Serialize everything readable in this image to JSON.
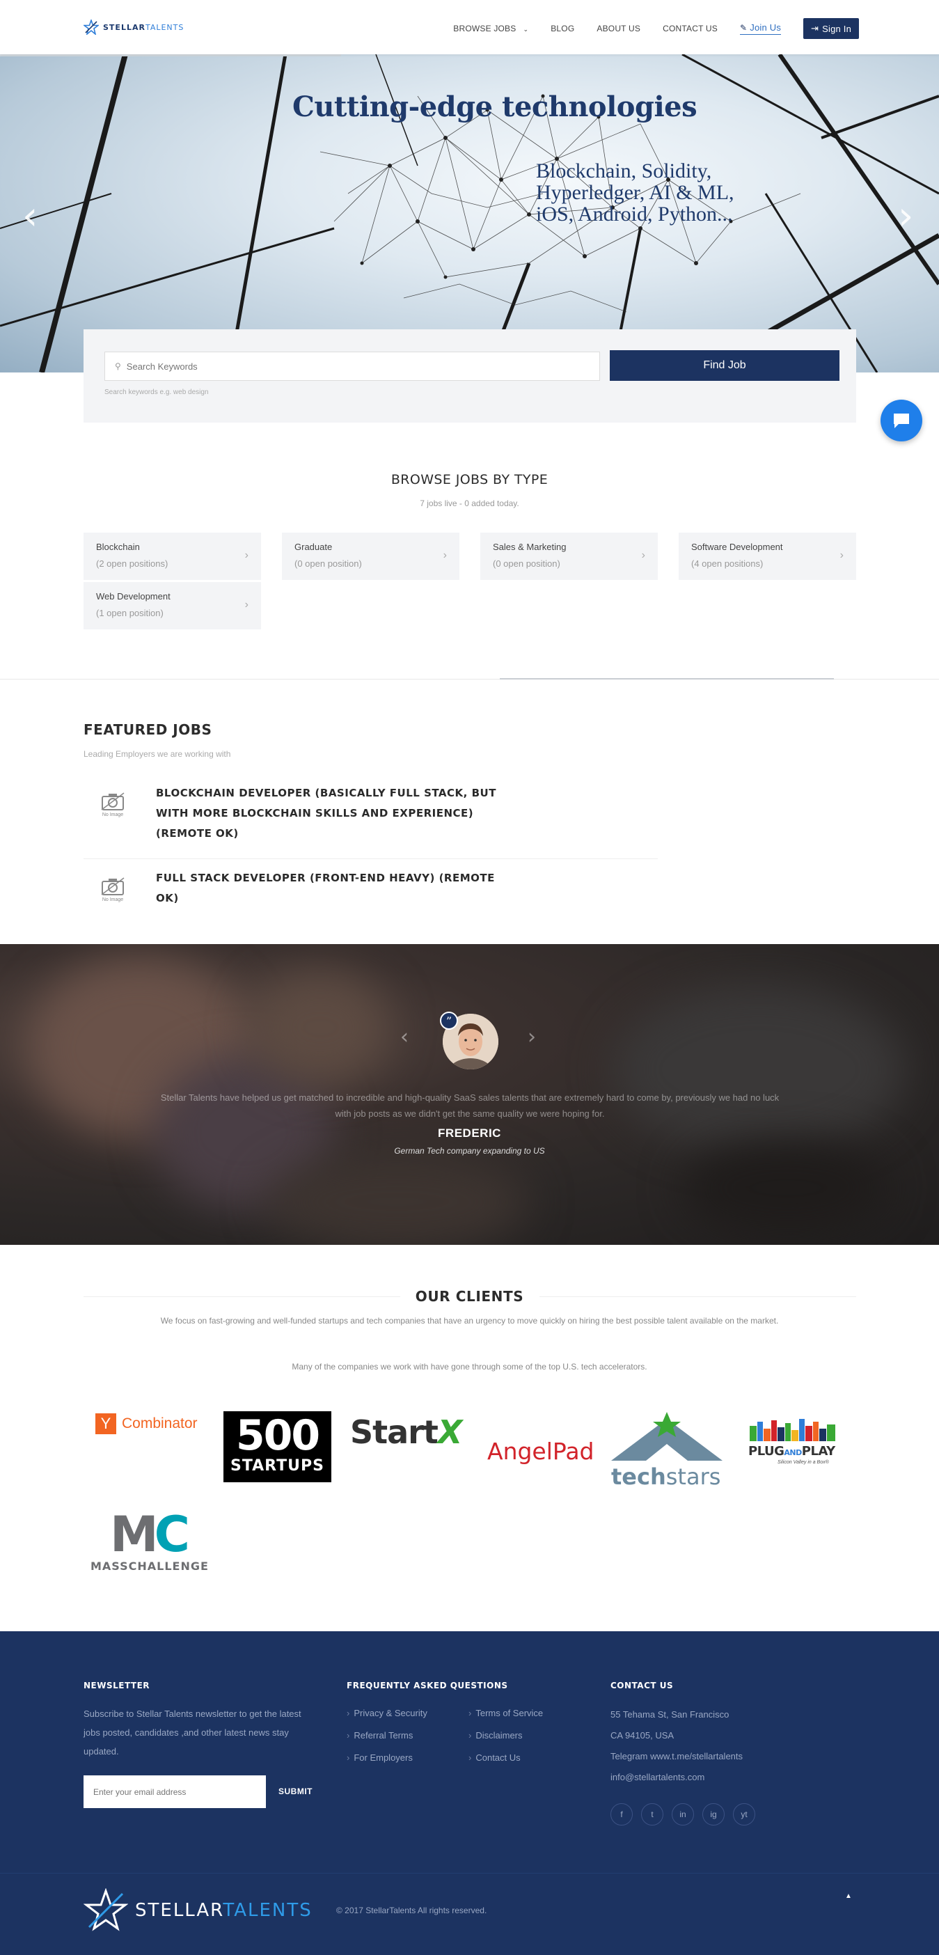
{
  "header": {
    "logo_bold": "STELLAR",
    "logo_light": "TALENTS",
    "nav": [
      "BROWSE JOBS",
      "BLOG",
      "ABOUT US",
      "CONTACT US"
    ],
    "join": "Join Us",
    "signin": "Sign In"
  },
  "hero": {
    "title": "Cutting-edge technologies",
    "subtitle": "Blockchain, Solidity, Hyperledger, AI & ML, iOS, Android, Python...",
    "prev": "‹",
    "next": "›"
  },
  "search": {
    "placeholder": "Search Keywords",
    "button": "Find Job",
    "hint": "Search keywords e.g. web design"
  },
  "browse": {
    "title": "BROWSE JOBS BY TYPE",
    "subtitle": "7 jobs live - 0 added today.",
    "categories": [
      {
        "name": "Blockchain",
        "count": "(2 open positions)"
      },
      {
        "name": "Graduate",
        "count": "(0 open position)"
      },
      {
        "name": "Sales & Marketing",
        "count": "(0 open position)"
      },
      {
        "name": "Software Development",
        "count": "(4 open positions)"
      },
      {
        "name": "Web Development",
        "count": "(1 open position)"
      }
    ]
  },
  "featured": {
    "title": "FEATURED JOBS",
    "subtitle": "Leading Employers we are working with",
    "no_image": "No Image",
    "jobs": [
      {
        "title": "BLOCKCHAIN DEVELOPER (BASICALLY FULL STACK, BUT WITH MORE BLOCKCHAIN SKILLS AND EXPERIENCE) (REMOTE OK)"
      },
      {
        "title": "FULL STACK DEVELOPER (FRONT-END HEAVY) (REMOTE OK)"
      }
    ]
  },
  "testimonial": {
    "quote": "Stellar Talents have helped us get matched to incredible and high-quality SaaS sales talents that are extremely hard to come by, previously we had no luck with job posts as we didn't get the same quality we were hoping for.",
    "name": "FREDERIC",
    "role": "German Tech company expanding to US",
    "quote_mark": "”"
  },
  "clients": {
    "title": "OUR CLIENTS",
    "desc": "We focus on fast-growing and well-funded startups and tech companies that have an urgency to move quickly on hiring the best possible talent available on the market.",
    "desc2": "Many of the companies we work with have gone through some of the top U.S. tech accelerators.",
    "logos": {
      "yc_y": "Y",
      "yc_name": "Combinator",
      "s500_top": "500",
      "s500_bottom": "STARTUPS",
      "startx": "Start",
      "startx_x": "X",
      "angelpad": "AngelPad",
      "techstars_a": "tech",
      "techstars_b": "stars",
      "plug_a": "PLUG",
      "plug_and": "AND",
      "plug_b": "PLAY",
      "plug_tag": "Silicon Valley in a Box®",
      "mc_m": "M",
      "mc_c": "C",
      "mc_name": "MASSCHALLENGE"
    }
  },
  "footer": {
    "newsletter_title": "NEWSLETTER",
    "newsletter_text": "Subscribe to Stellar Talents newsletter to get the latest jobs posted, candidates ,and other latest news stay updated.",
    "email_placeholder": "Enter your email address",
    "submit": "SUBMIT",
    "faq_title": "FREQUENTLY ASKED QUESTIONS",
    "faq_col1": [
      "Privacy & Security",
      "Referral Terms",
      "For Employers"
    ],
    "faq_col2": [
      "Terms of Service",
      "Disclaimers",
      "Contact Us"
    ],
    "contact_title": "CONTACT US",
    "contact_lines": [
      "55 Tehama St, San Francisco",
      "CA 94105, USA",
      "Telegram www.t.me/stellartalents",
      "info@stellartalents.com"
    ],
    "social": [
      "f",
      "t",
      "in",
      "ig",
      "yt"
    ],
    "logo_bold": "STELLAR",
    "logo_light": "TALENTS",
    "copyright": "© 2017 StellarTalents All rights reserved.",
    "scrolltop": "▲"
  }
}
